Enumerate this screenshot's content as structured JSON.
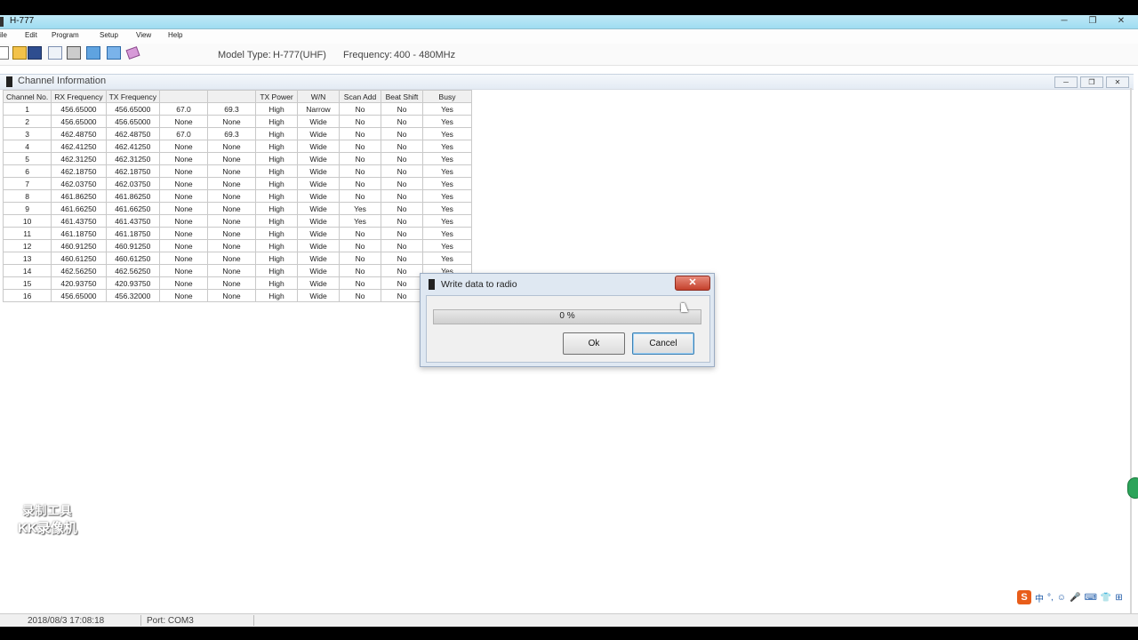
{
  "window": {
    "title": "H-777",
    "controls": [
      "─",
      "❐",
      "✕"
    ]
  },
  "menu": [
    "ile",
    "Edit",
    "Program",
    "Setup",
    "View",
    "Help"
  ],
  "toolbar": {
    "icons": [
      "new-icon",
      "open-icon",
      "save-icon",
      "edit-icon",
      "print-icon",
      "read-icon",
      "write-icon",
      "eraser-icon"
    ],
    "model_type_label": "Model Type:",
    "model_type_value": "H-777(UHF)",
    "frequency_label": "Frequency:",
    "frequency_value": "400 - 480MHz"
  },
  "channel_window": {
    "title": "Channel Information",
    "controls": [
      "─",
      "❐",
      "✕"
    ]
  },
  "table": {
    "headers": [
      "Channel No.",
      "RX Frequency",
      "TX Frequency",
      "",
      "",
      "TX Power",
      "W/N",
      "Scan Add",
      "Beat Shift",
      "Busy"
    ],
    "rows": [
      [
        "1",
        "456.65000",
        "456.65000",
        "67.0",
        "69.3",
        "High",
        "Narrow",
        "No",
        "No",
        "Yes"
      ],
      [
        "2",
        "456.65000",
        "456.65000",
        "None",
        "None",
        "High",
        "Wide",
        "No",
        "No",
        "Yes"
      ],
      [
        "3",
        "462.48750",
        "462.48750",
        "67.0",
        "69.3",
        "High",
        "Wide",
        "No",
        "No",
        "Yes"
      ],
      [
        "4",
        "462.41250",
        "462.41250",
        "None",
        "None",
        "High",
        "Wide",
        "No",
        "No",
        "Yes"
      ],
      [
        "5",
        "462.31250",
        "462.31250",
        "None",
        "None",
        "High",
        "Wide",
        "No",
        "No",
        "Yes"
      ],
      [
        "6",
        "462.18750",
        "462.18750",
        "None",
        "None",
        "High",
        "Wide",
        "No",
        "No",
        "Yes"
      ],
      [
        "7",
        "462.03750",
        "462.03750",
        "None",
        "None",
        "High",
        "Wide",
        "No",
        "No",
        "Yes"
      ],
      [
        "8",
        "461.86250",
        "461.86250",
        "None",
        "None",
        "High",
        "Wide",
        "No",
        "No",
        "Yes"
      ],
      [
        "9",
        "461.66250",
        "461.66250",
        "None",
        "None",
        "High",
        "Wide",
        "Yes",
        "No",
        "Yes"
      ],
      [
        "10",
        "461.43750",
        "461.43750",
        "None",
        "None",
        "High",
        "Wide",
        "Yes",
        "No",
        "Yes"
      ],
      [
        "11",
        "461.18750",
        "461.18750",
        "None",
        "None",
        "High",
        "Wide",
        "No",
        "No",
        "Yes"
      ],
      [
        "12",
        "460.91250",
        "460.91250",
        "None",
        "None",
        "High",
        "Wide",
        "No",
        "No",
        "Yes"
      ],
      [
        "13",
        "460.61250",
        "460.61250",
        "None",
        "None",
        "High",
        "Wide",
        "No",
        "No",
        "Yes"
      ],
      [
        "14",
        "462.56250",
        "462.56250",
        "None",
        "None",
        "High",
        "Wide",
        "No",
        "No",
        "Yes"
      ],
      [
        "15",
        "420.93750",
        "420.93750",
        "None",
        "None",
        "High",
        "Wide",
        "No",
        "No",
        ""
      ],
      [
        "16",
        "456.65000",
        "456.32000",
        "None",
        "None",
        "High",
        "Wide",
        "No",
        "No",
        ""
      ]
    ]
  },
  "dialog": {
    "title": "Write data to radio",
    "close": "✕",
    "progress_text": "0 %",
    "progress_fraction": 0,
    "ok_label": "Ok",
    "cancel_label": "Cancel"
  },
  "watermark": {
    "line1": "录制工具",
    "line2": "KK录像机"
  },
  "status": {
    "datetime": "2018/08/3  17:08:18",
    "port": "Port: COM3"
  },
  "ime": [
    "S",
    "中",
    "°,",
    "☺",
    "🎤",
    "⌨",
    "👕",
    "⊞"
  ]
}
